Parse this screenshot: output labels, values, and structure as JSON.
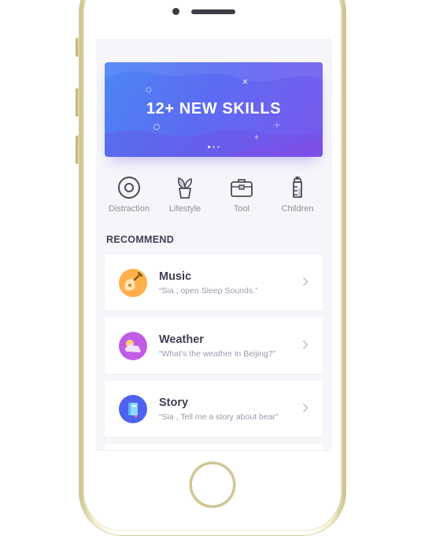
{
  "banner": {
    "title": "12+  NEW SKILLS",
    "page_count": 3,
    "active_page": 1
  },
  "categories": [
    {
      "label": "Distraction",
      "icon": "disc-icon"
    },
    {
      "label": "Lifestyle",
      "icon": "plant-pot-icon"
    },
    {
      "label": "Tool",
      "icon": "toolbox-icon"
    },
    {
      "label": "Children",
      "icon": "baby-bottle-icon"
    }
  ],
  "recommend": {
    "title": "RECOMMEND",
    "items": [
      {
        "title": "Music",
        "subtitle": "“Sia , open Sleep Sounds.”",
        "icon": "guitar-icon"
      },
      {
        "title": "Weather",
        "subtitle": "“What’s the weather in Beijing?”",
        "icon": "weather-icon"
      },
      {
        "title": "Story",
        "subtitle": "“Sia , Tell me a story about bear”",
        "icon": "book-icon"
      }
    ]
  },
  "colors": {
    "banner_start": "#4c86f4",
    "banner_end": "#7b58ee",
    "music_icon_bg": "#ffb04a",
    "weather_icon_bg": "#c05ce6",
    "story_icon_bg": "#4d63f0",
    "title_text": "#3f3e55",
    "muted_text": "#9b9aab"
  }
}
